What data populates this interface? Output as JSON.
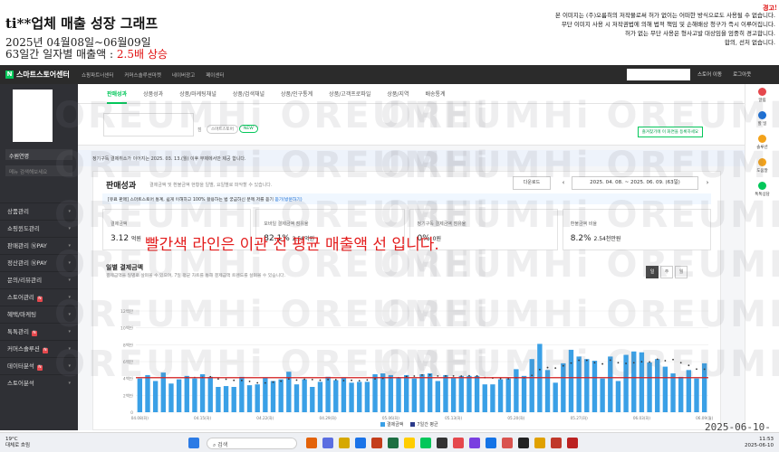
{
  "header": {
    "title": "ti**업체 매출 성장 그래프",
    "date_range": "2025년 04월08일~06월09일",
    "summary_prefix": "63일간 일자별 매출액 : ",
    "summary_highlight": "2.5배 상승",
    "warning": "경고!",
    "notice": [
      "본 이미지는 (주)오름히의 저작물로써 허가 없이는 어떠한 방식으로도 사용될 수 없습니다.",
      "무단 이미지 사용 시 저작권법에 의해 법적 책임 및 손해배상 청구가 즉시 이루어집니다.",
      "허가 없는 무단 사용은 형사고발 대상임을 엄중히 경고합니다.",
      "합의, 선처 없습니다."
    ]
  },
  "topbar": {
    "brand": "스마트스토어센터",
    "nav": [
      "쇼핑파트너센터",
      "커머스솔루션마켓",
      "네이버광고",
      "페이센터"
    ],
    "right": [
      "스토어 이동",
      "로그아웃"
    ]
  },
  "sidebar": {
    "store_select": "수원연명",
    "search_placeholder": "메뉴 검색해보세요",
    "items": [
      {
        "label": "상품관리",
        "new": false
      },
      {
        "label": "쇼핑윈도관리",
        "new": false
      },
      {
        "label": "판매관리 ⓃPAY",
        "new": false
      },
      {
        "label": "정산관리 ⓃPAY",
        "new": false
      },
      {
        "label": "문의/리뷰관리",
        "new": false
      },
      {
        "label": "스토어관리",
        "new": true
      },
      {
        "label": "혜택/마케팅",
        "new": false
      },
      {
        "label": "톡톡관리",
        "new": true
      },
      {
        "label": "커머스솔루션",
        "new": true
      },
      {
        "label": "데이터분석",
        "new": true
      },
      {
        "label": "스토어분석",
        "new": false
      }
    ]
  },
  "tabs": [
    "판매성과",
    "상품성과",
    "상품/마케팅채널",
    "상품/검색채널",
    "상품/인구통계",
    "상품/고객프로파일",
    "상품/지역",
    "배송통계"
  ],
  "store": {
    "chip_label": "스마트스토어",
    "badge": "NEW",
    "favorite_button": "즐겨찾기에 이 화면을 등록하세요"
  },
  "info_bar": "정기구독 결제취소가 이어지는 2025. 03. 13.(월) 이후 부제에서만 제공 합니다.",
  "performance": {
    "title": "판매성과",
    "subtitle": "결제금액 및 환불금액 현황을 일별, 요일별로 파악할 수 있습니다.",
    "download_label": "다운로드",
    "date_range": "2025. 04. 08. ~ 2025. 06. 09. (63일)",
    "hint": "[유료 판매] 스마트스토어 통계, 쉽게 이해하고 100% 활용하는 법 궁금하신 분께 저를 듣기",
    "hint_link": "듣기(방문하기)",
    "cards": [
      {
        "label": "결제금액",
        "value": "3.12",
        "unit": "억원"
      },
      {
        "label": "모바일 결제금액 점유율",
        "value": "82.1%",
        "unit": "2.56억원"
      },
      {
        "label": "정기구독 결제금액 점유율",
        "value": "0%",
        "unit": "0원"
      },
      {
        "label": "환불금액 비율",
        "value": "8.2%",
        "unit": "2.54천만원"
      }
    ]
  },
  "daily": {
    "title": "일별 결제금액",
    "subtitle": "결제금액을 일별로 살펴볼 수 있으며, 7일 평균 차트를 통해 결제금액 트렌드를 살펴볼 수 있습니다.",
    "view_toggle": [
      "일",
      "주",
      "월"
    ],
    "overlay_note": "빨간색 라인은 이관 전 평균 매출액 선 입니다."
  },
  "chart_data": {
    "type": "bar",
    "ylim": [
      0,
      12
    ],
    "yticks": [
      "0",
      "2백만",
      "4백만",
      "6백만",
      "8백만",
      "10백만",
      "12백만"
    ],
    "xtick_labels": [
      "04.08(화)",
      "04.15(화)",
      "04.22(화)",
      "04.29(화)",
      "05.06(화)",
      "05.13(화)",
      "05.20(화)",
      "05.27(화)",
      "06.03(화)",
      "06.09(월)"
    ],
    "values": [
      4.0,
      4.4,
      3.7,
      4.7,
      3.4,
      3.9,
      4.3,
      4.0,
      4.5,
      4.2,
      3.0,
      3.1,
      3.0,
      4.2,
      3.2,
      3.3,
      4.1,
      3.7,
      3.9,
      4.8,
      3.3,
      3.9,
      3.0,
      3.6,
      4.2,
      3.8,
      4.1,
      3.5,
      3.6,
      3.6,
      4.5,
      4.6,
      4.4,
      4.1,
      4.4,
      4.0,
      4.5,
      4.6,
      3.7,
      4.4,
      4.1,
      4.3,
      4.3,
      4.3,
      3.3,
      3.3,
      3.9,
      4.0,
      5.1,
      4.3,
      6.3,
      8.1,
      5.0,
      3.5,
      5.8,
      7.4,
      6.6,
      6.3,
      6.1,
      4.0,
      6.6,
      3.7,
      6.8,
      7.2,
      7.1,
      5.9,
      6.3,
      5.4,
      4.6,
      4.2,
      5.0,
      4.0,
      5.8
    ],
    "series": [
      {
        "name": "결제금액",
        "color": "#3aa0e6"
      },
      {
        "name": "7일간 평균",
        "color": "#333333"
      }
    ],
    "reference_line": {
      "value": 4.1,
      "color": "#d62020"
    }
  },
  "right_rail": [
    {
      "label": "알림",
      "color": "#e5484d"
    },
    {
      "label": "할 일",
      "color": "#1a6fd6"
    },
    {
      "label": "솔루션",
      "color": "#f3a21a"
    },
    {
      "label": "도움말",
      "color": "#f3a21a"
    },
    {
      "label": "톡톡상담",
      "color": "#03c75a"
    }
  ],
  "watermark": "OREUMHi",
  "timestamp_overlay": "2025-06-10-",
  "taskbar": {
    "weather_temp": "19°C",
    "weather_desc": "대체로 흐림",
    "search_label": "검색",
    "time": "11:53",
    "date": "2025-06-10"
  }
}
